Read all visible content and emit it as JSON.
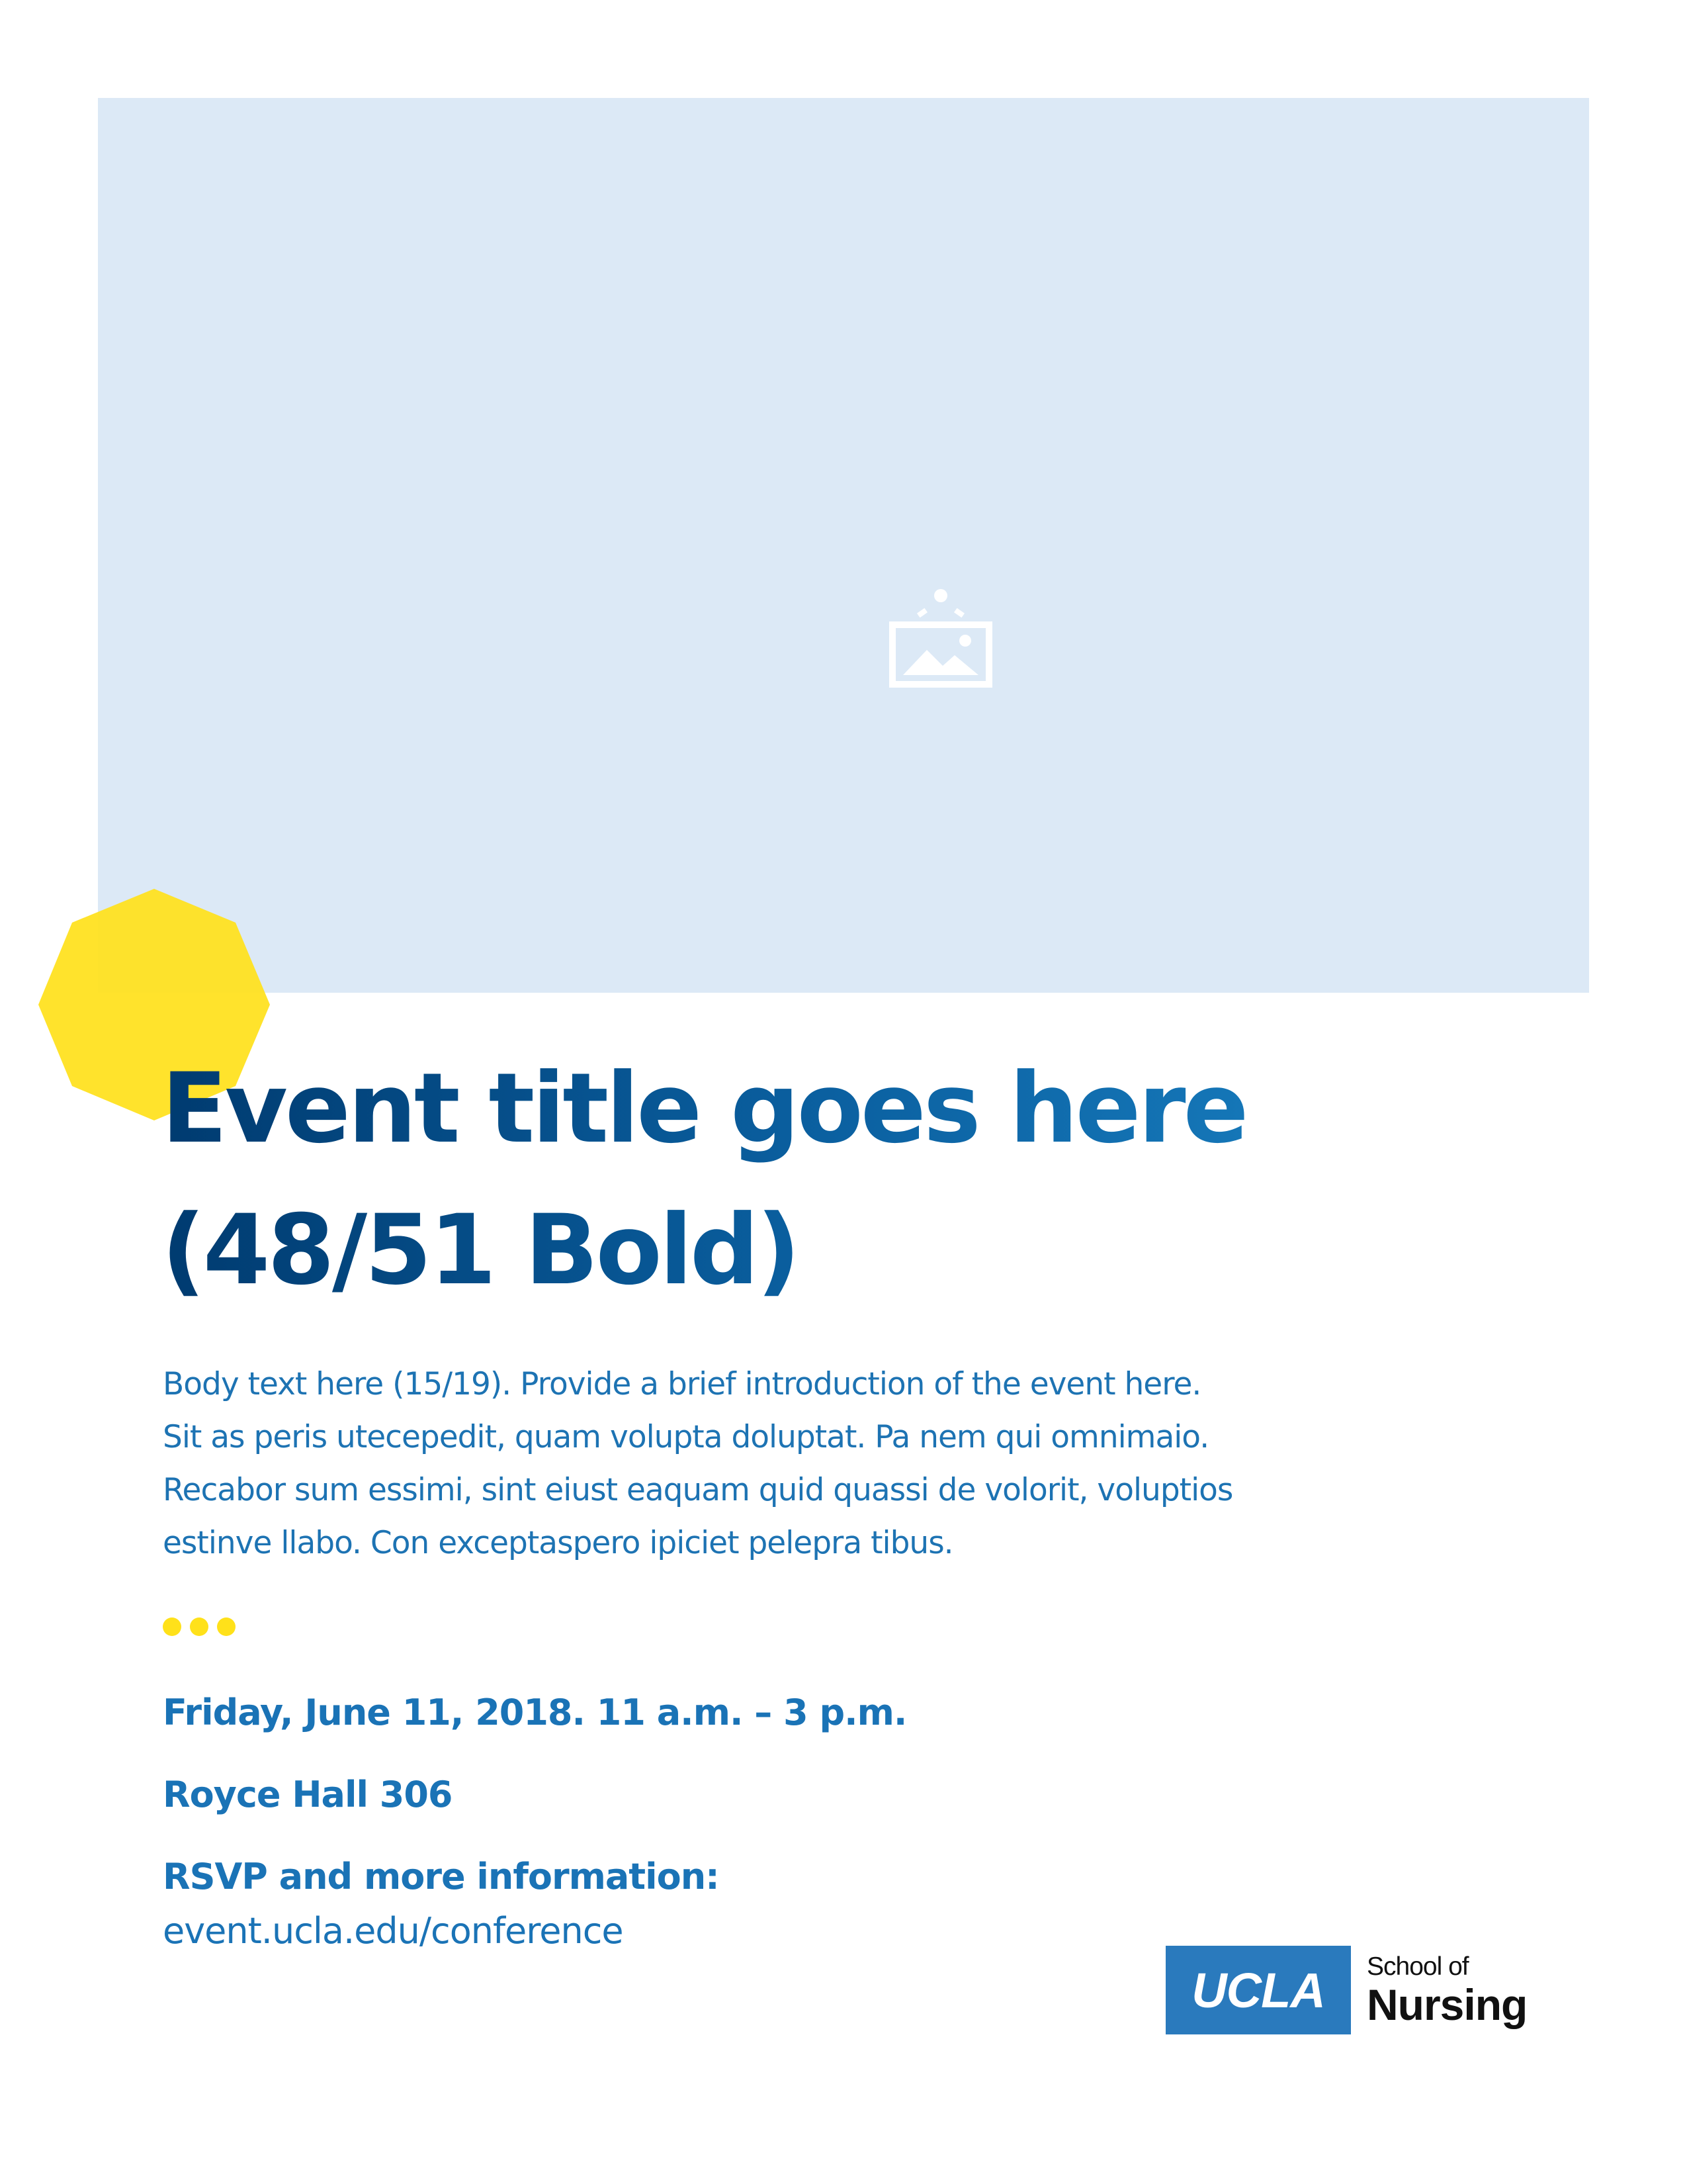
{
  "hero": {
    "image_placeholder_icon": "image-icon",
    "background_color": "#dce9f6"
  },
  "decoration": {
    "shape": "octagon",
    "color": "#ffe11a",
    "dots_count": 3
  },
  "event": {
    "title_lines": [
      "Event title goes here",
      "(48/51 Bold)"
    ],
    "body_lines": [
      "Body text here (15/19). Provide a brief introduction of the event here.",
      "Sit as peris utecepedit, quam volupta doluptat. Pa nem qui omnimaio.",
      "Recabor sum essimi, sint eiust eaquam quid quassi de volorit, voluptios",
      "estinve llabo. Con exceptaspero ipiciet pelepra tibus."
    ],
    "date_time": "Friday, June 11, 2018. 11 a.m. – 3 p.m.",
    "location": "Royce Hall 306",
    "rsvp_label": "RSVP and more information:",
    "rsvp_url": "event.ucla.edu/conference"
  },
  "logo": {
    "box_text": "UCLA",
    "school_top": "School of",
    "school_bottom": "Nursing",
    "brand_color": "#2a7abd"
  },
  "colors": {
    "title_dark": "#003b70",
    "title_light": "#1c86c8",
    "body_text": "#1d73b3",
    "accent_yellow": "#ffe11a"
  }
}
